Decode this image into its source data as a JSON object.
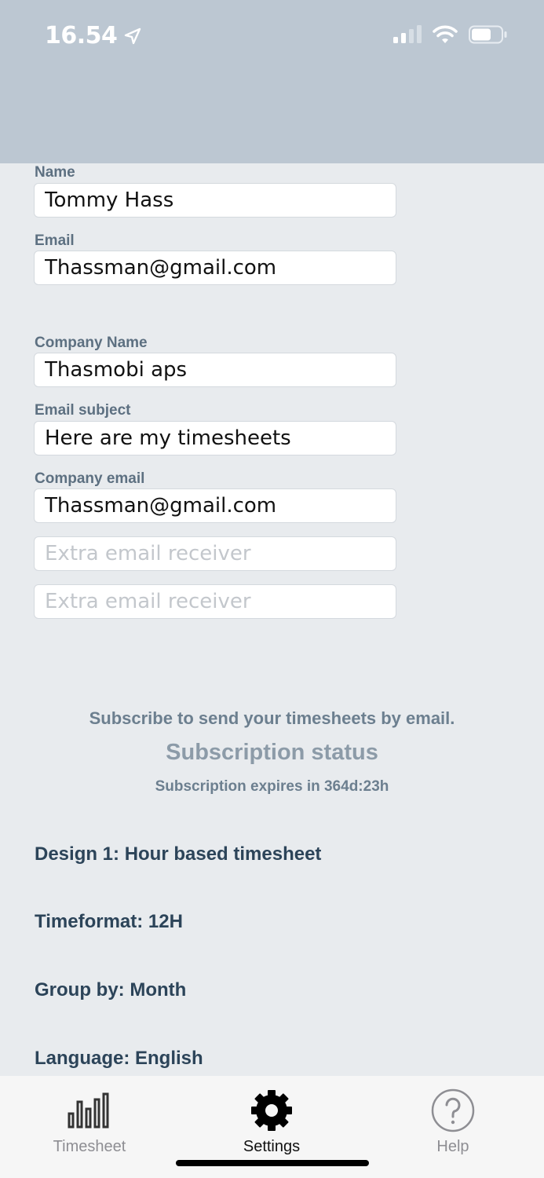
{
  "status_bar": {
    "time": "16.54",
    "icons": [
      "location-arrow-icon",
      "cellular-signal-icon",
      "wifi-icon",
      "battery-icon"
    ]
  },
  "form": {
    "name": {
      "label": "Name",
      "value": "Tommy Hass"
    },
    "email": {
      "label": "Email",
      "value": "Thassman@gmail.com"
    },
    "company_name": {
      "label": "Company Name",
      "value": "Thasmobi aps"
    },
    "email_subject": {
      "label": "Email subject",
      "value": "Here are my timesheets"
    },
    "company_email": {
      "label": "Company email",
      "value": "Thassman@gmail.com"
    },
    "extra_receiver_1": {
      "placeholder": "Extra email receiver",
      "value": ""
    },
    "extra_receiver_2": {
      "placeholder": "Extra email receiver",
      "value": ""
    }
  },
  "subscription": {
    "prompt": "Subscribe to send your timesheets by email.",
    "status_title": "Subscription status",
    "expires": "Subscription expires in 364d:23h"
  },
  "settings": {
    "design": "Design 1: Hour based timesheet",
    "timeformat": "Timeformat: 12H",
    "group_by": "Group by: Month",
    "language": "Language: English"
  },
  "tabbar": {
    "tabs": [
      {
        "label": "Timesheet",
        "icon": "bar-chart-icon",
        "active": false
      },
      {
        "label": "Settings",
        "icon": "gear-icon",
        "active": true
      },
      {
        "label": "Help",
        "icon": "help-circle-icon",
        "active": false
      }
    ]
  },
  "colors": {
    "header_bg": "#bcc7d2",
    "page_bg": "#e8ebee",
    "label": "#5d7081",
    "setting_text": "#2c4459",
    "tab_inactive": "#8e8e93"
  }
}
